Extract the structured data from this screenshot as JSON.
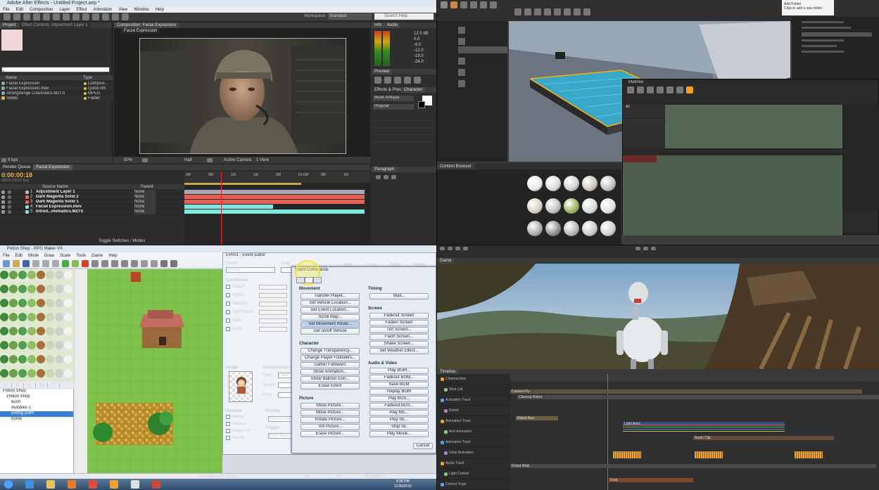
{
  "after_effects": {
    "title": "Adobe After Effects - Untitled Project.aep *",
    "menu": [
      "File",
      "Edit",
      "Composition",
      "Layer",
      "Effect",
      "Animation",
      "View",
      "Window",
      "Help"
    ],
    "workspace_label": "Workspace:",
    "workspace_value": "Standard",
    "search_placeholder": "Search Help",
    "project_tab": "Project",
    "effect_controls_tab": "Effect Controls: Adjustment Layer 1",
    "composition_tab": "Composition: Facial Expression",
    "comp_subtab": "Facial Expression",
    "project_headers": {
      "name": "Name",
      "type": "Type"
    },
    "project_items": [
      {
        "name": "Facial Expression",
        "type": "Composi..."
      },
      {
        "name": "Facial Expression.mov",
        "type": "QuickTim"
      },
      {
        "name": "Stronghenge Cinematics.M2TS",
        "type": "MPEG"
      },
      {
        "name": "Solids",
        "type": "Folder"
      }
    ],
    "bpc": "8 bpc",
    "zoom": "50%",
    "resolution": "Half",
    "camera": "Active Camera",
    "view": "1 View",
    "info_tab": "Info",
    "audio_tab": "Audio",
    "audio_db": [
      "12.0 dB",
      "0.0",
      "-6.0",
      "-12.0",
      "-18.0",
      "-24.0"
    ],
    "preview_tab": "Preview",
    "character_tab": "Character",
    "effects_tab": "Effects & Presets",
    "font_name": "Book Antiqua",
    "font_style": "Regular",
    "paragraph_tab": "Paragraph",
    "timeline_tabs": [
      "Render Queue",
      "Facial Expression"
    ],
    "timecode": "0:00:00:18",
    "timecode_sub": "00018 (29.97 fps)",
    "layer_header": "Source Name",
    "parent_header": "Parent",
    "layers": [
      {
        "num": "1",
        "name": "Adjustment Layer 1",
        "parent": "None",
        "color": "#b9b9b9"
      },
      {
        "num": "2",
        "name": "Dark Magenta Solid 2",
        "parent": "None",
        "color": "#e46a5c"
      },
      {
        "num": "3",
        "name": "Dark Magenta Solid 1",
        "parent": "None",
        "color": "#e46a5c"
      },
      {
        "num": "4",
        "name": "Facial Expression.mov",
        "parent": "None",
        "color": "#8ee0d9"
      },
      {
        "num": "5",
        "name": "Introd...inematics.M2TS",
        "parent": "None",
        "color": "#8ee0d9"
      }
    ],
    "ruler": [
      "00f",
      "05f",
      "10f",
      "15f",
      "20f",
      "01:00f",
      "05f",
      "10f"
    ],
    "toggle_label": "Toggle Switches / Modes"
  },
  "unreal": {
    "tabs": [
      "Content Browser"
    ],
    "matinee_title": "Matinee",
    "tracks_title": "All",
    "menu_hint": "Add Folder",
    "help_text": "Click to add a new folder"
  },
  "rpgmaker": {
    "title": "Potion Shop - RPG Maker VX",
    "menu": [
      "File",
      "Edit",
      "Mode",
      "Draw",
      "Scale",
      "Tools",
      "Game",
      "Help"
    ],
    "tile_tabs": [
      "A",
      "B",
      "C",
      "D",
      "E"
    ],
    "map_tree": [
      "Potion Shop",
      "Potion Shop",
      "bush",
      "Autotiles 1",
      "exiting point",
      "home"
    ],
    "selected_tree": "exiting point",
    "event_title": "EV001 - Event Editor",
    "name_label": "Name:",
    "name_value": "EV001",
    "note_label": "Note:",
    "toolbar_btns": [
      "New",
      "Copy",
      "Paste",
      "Delete"
    ],
    "conditions_title": "Conditions",
    "conditions": [
      "Switch",
      "Switch",
      "Variable",
      "Self Switch",
      "Item",
      "Actor"
    ],
    "image_title": "Image",
    "autonomous_title": "Autonomous Movement",
    "type_label": "Type:",
    "type_value": "Fixed",
    "speed_label": "Speed:",
    "freq_label": "Freq:",
    "options_title": "Options",
    "options": [
      "Walking",
      "Stepping",
      "Direction Fix",
      "Through"
    ],
    "priority_title": "Priority",
    "priority_value": "Same as characters",
    "trigger_title": "Trigger",
    "trigger_value": "Action Button",
    "event_commands_title": "Event Commands",
    "cmd_tabs": [
      "1",
      "2",
      "3"
    ],
    "movement_title": "Movement",
    "movement_cmds": [
      "Transfer Player...",
      "Set Vehicle Location...",
      "Set Event Location...",
      "Scroll Map...",
      "Set Movement Route...",
      "Get on/off Vehicle"
    ],
    "character_title": "Character",
    "character_cmds": [
      "Change Transparency...",
      "Change Player Followers...",
      "Gather Followers",
      "Show Animation...",
      "Show Balloon Icon...",
      "Erase Event"
    ],
    "picture_title": "Picture",
    "picture_cmds": [
      "Show Picture...",
      "Move Picture...",
      "Rotate Picture...",
      "Tint Picture...",
      "Erase Picture..."
    ],
    "timing_title": "Timing",
    "timing_cmds": [
      "Wait..."
    ],
    "screen_title": "Screen",
    "screen_cmds": [
      "Fadeout Screen",
      "Fadein Screen",
      "Tint Screen...",
      "Flash Screen...",
      "Shake Screen...",
      "Set Weather Effect..."
    ],
    "audio_title": "Audio & Video",
    "audio_cmds": [
      "Play BGM...",
      "Fadeout BGM...",
      "Save BGM",
      "Replay BGM",
      "Play BGS...",
      "Fadeout BGS...",
      "Play ME...",
      "Play SE...",
      "Stop SE",
      "Play Movie..."
    ],
    "cancel": "Cancel",
    "status_left": "001:exiting point (17x13)",
    "status_mid": "1%",
    "status_coord": "5,8",
    "status_right": "001:EV001 1",
    "clock_time": "4:36 PM",
    "clock_date": "11/30/2016"
  },
  "unity": {
    "game_tab": "Game",
    "timeline_tab": "Timeline",
    "track_labels": [
      "Cinemachine",
      "Shot List",
      "Activation Track",
      "Robot",
      "Animation Track",
      "Arm Animation",
      "Animation Track",
      "Unity Animation",
      "Audio Track",
      "Light Control",
      "Control Track"
    ],
    "clips": [
      "Camera Fly",
      "Closeup Robot",
      "Robot Run",
      "Light Anim",
      "Audio Clip",
      "Robot Walk",
      "Dust"
    ]
  },
  "taskbar_icons": [
    "windows-start-icon",
    "ie-icon",
    "folder-icon",
    "media-icon",
    "chrome-icon",
    "winamp-icon",
    "window-icon",
    "rpgmaker-icon"
  ]
}
